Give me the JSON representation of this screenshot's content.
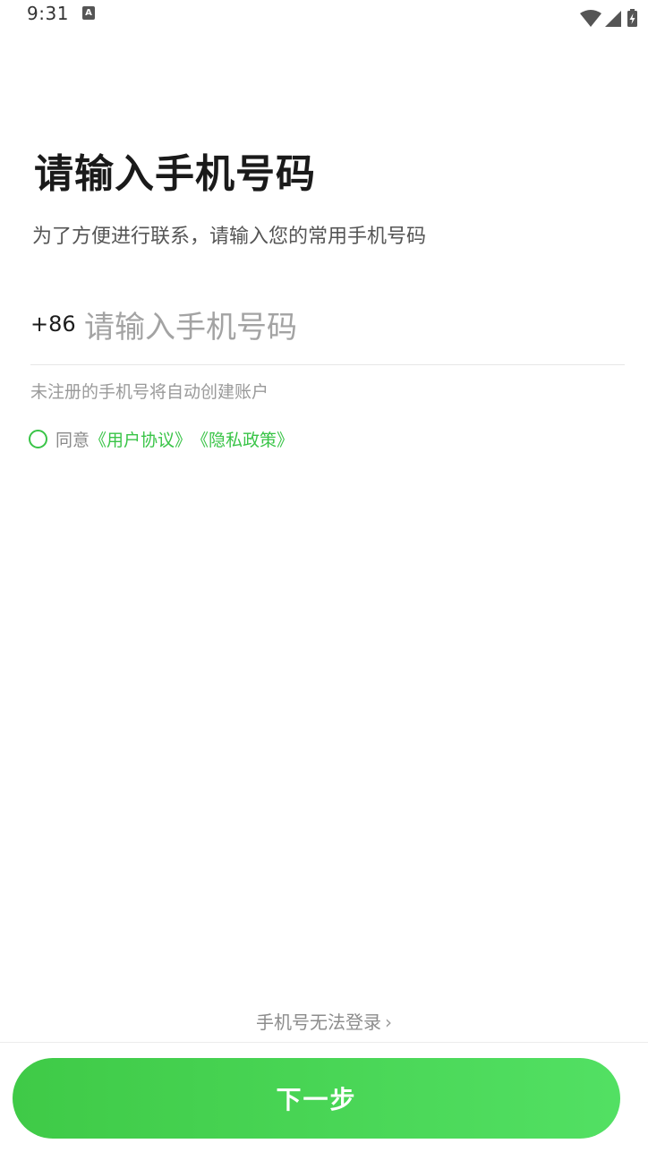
{
  "status_bar": {
    "time": "9:31",
    "notification_icon": "keyboard-a-icon",
    "notification_glyph": "A",
    "icons": [
      "wifi-icon",
      "cell-signal-icon",
      "battery-charging-icon"
    ]
  },
  "header": {
    "title": "请输入手机号码",
    "subtitle": "为了方便进行联系，请输入您的常用手机号码"
  },
  "phone": {
    "country_code": "+86",
    "value": "",
    "placeholder": "请输入手机号码"
  },
  "hint": "未注册的手机号将自动创建账户",
  "agreement": {
    "checked": false,
    "prefix": "同意",
    "user_agreement": "《用户协议》",
    "privacy_policy": "《隐私政策》"
  },
  "footer": {
    "cannot_login_label": "手机号无法登录",
    "chevron": "›",
    "next_button_label": "下一步"
  },
  "colors": {
    "accent_green": "#39c447",
    "button_gradient_start": "#3fca47",
    "button_gradient_end": "#52e063",
    "title_text": "#1a1a1a",
    "hint_text": "#9a9a9a"
  }
}
